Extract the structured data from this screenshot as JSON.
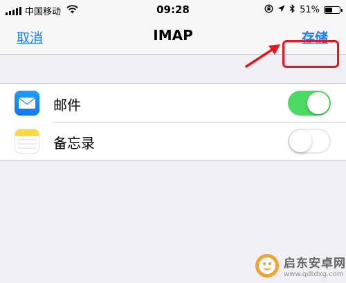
{
  "status_bar": {
    "carrier": "中国移动",
    "time": "09:28",
    "battery": "51%",
    "battery_level": 0.51,
    "icons": [
      "signal-icon",
      "wifi-icon",
      "orientation-lock-icon",
      "location-icon",
      "bluetooth-icon",
      "battery-icon"
    ]
  },
  "nav": {
    "cancel_label": "取消",
    "title": "IMAP",
    "save_label": "存储"
  },
  "list": {
    "items": [
      {
        "label": "邮件",
        "icon": "mail-app-icon",
        "enabled": true
      },
      {
        "label": "备忘录",
        "icon": "notes-app-icon",
        "enabled": false
      }
    ]
  },
  "watermark": {
    "text": "启东安卓网",
    "url": "www.qdtdxg.com"
  },
  "colors": {
    "accent": "#1a7ef5",
    "toggle_on": "#4cd964",
    "highlight": "#e8141b",
    "background": "#efeff4"
  }
}
